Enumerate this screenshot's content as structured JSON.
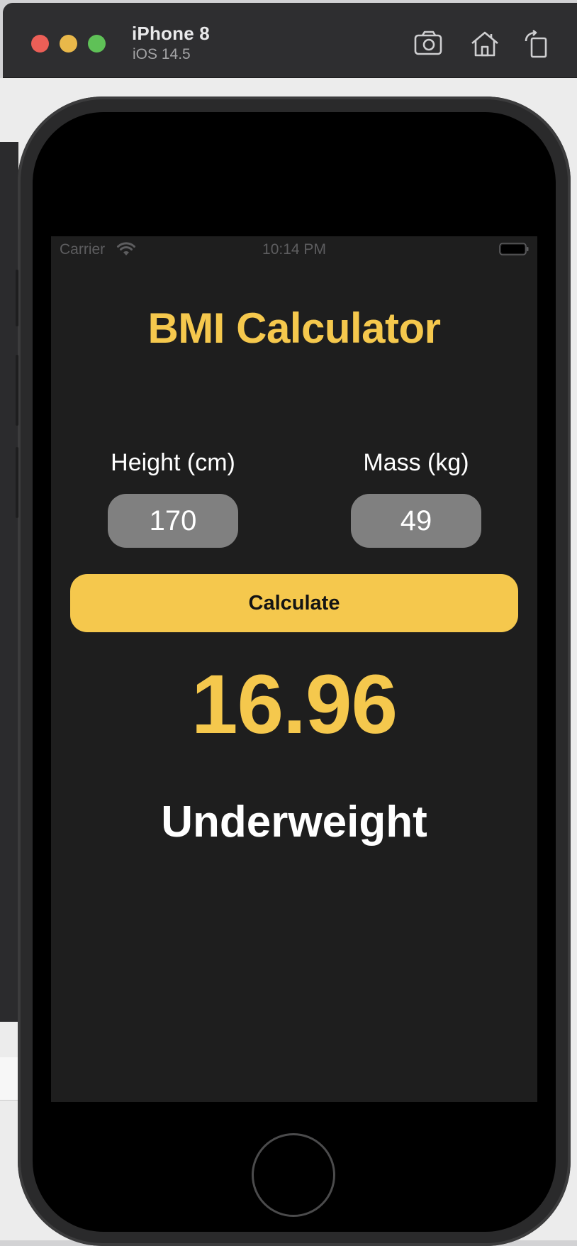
{
  "simulator": {
    "device_name": "iPhone 8",
    "os_version": "iOS 14.5",
    "toolbar_icons": [
      "screenshot-icon",
      "home-icon",
      "rotate-icon"
    ]
  },
  "status_bar": {
    "carrier": "Carrier",
    "time": "10:14 PM"
  },
  "app": {
    "title": "BMI Calculator",
    "height_label": "Height (cm)",
    "height_value": "170",
    "mass_label": "Mass (kg)",
    "mass_value": "49",
    "calculate_label": "Calculate",
    "bmi_value": "16.96",
    "bmi_category": "Underweight"
  },
  "colors": {
    "accent": "#f5c84d",
    "screen_background": "#1e1e1e",
    "input_background": "#808080",
    "text": "#ffffff"
  }
}
